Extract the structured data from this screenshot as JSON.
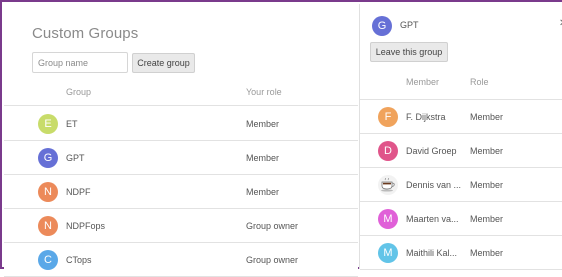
{
  "left": {
    "title": "Custom Groups",
    "group_input": {
      "placeholder": "Group name",
      "value": ""
    },
    "create_label": "Create group",
    "columns": {
      "group": "Group",
      "role": "Your role"
    },
    "rows": [
      {
        "initial": "E",
        "name": "ET",
        "role": "Member",
        "color": "#c8dc6a"
      },
      {
        "initial": "G",
        "name": "GPT",
        "role": "Member",
        "color": "#6670d6"
      },
      {
        "initial": "N",
        "name": "NDPF",
        "role": "Member",
        "color": "#ec8a5a"
      },
      {
        "initial": "N",
        "name": "NDPFops",
        "role": "Group owner",
        "color": "#ec8a5a"
      },
      {
        "initial": "C",
        "name": "CTops",
        "role": "Group owner",
        "color": "#5aa8e8"
      }
    ]
  },
  "right": {
    "group": {
      "initial": "G",
      "name": "GPT",
      "color": "#6670d6"
    },
    "close_icon": "close-icon",
    "leave_label": "Leave this group",
    "columns": {
      "member": "Member",
      "role": "Role"
    },
    "rows": [
      {
        "initial": "F",
        "name": "F. Dijkstra",
        "role": "Member",
        "color": "#f0a35c",
        "icon": ""
      },
      {
        "initial": "D",
        "name": "David Groep",
        "role": "Member",
        "color": "#e0558a",
        "icon": ""
      },
      {
        "initial": "",
        "name": "Dennis van ...",
        "role": "Member",
        "color": "#f2f2f2",
        "icon": "coffee-cup-icon"
      },
      {
        "initial": "M",
        "name": "Maarten va...",
        "role": "Member",
        "color": "#e060d8",
        "icon": ""
      },
      {
        "initial": "M",
        "name": "Maithili Kal...",
        "role": "Member",
        "color": "#62c4e8",
        "icon": ""
      }
    ]
  }
}
